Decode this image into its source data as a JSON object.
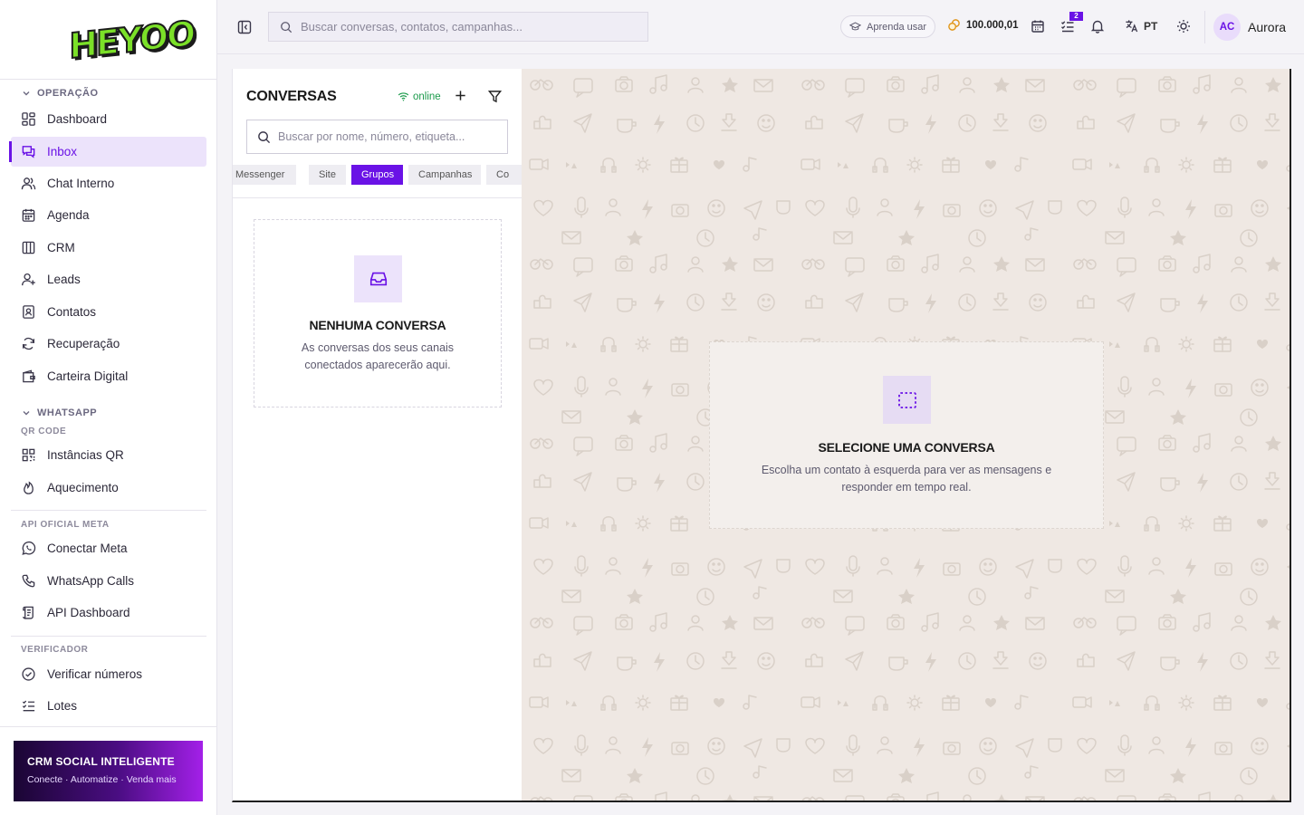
{
  "brand": {
    "logo_text": "HEYOO"
  },
  "sidebar": {
    "sections": [
      {
        "title": "OPERAÇÃO",
        "items": [
          {
            "label": "Dashboard",
            "icon": "dashboard-icon"
          },
          {
            "label": "Inbox",
            "icon": "inbox-icon",
            "active": true
          },
          {
            "label": "Chat Interno",
            "icon": "users-icon"
          },
          {
            "label": "Agenda",
            "icon": "calendar-icon"
          },
          {
            "label": "CRM",
            "icon": "kanban-icon"
          },
          {
            "label": "Leads",
            "icon": "user-plus-icon"
          },
          {
            "label": "Contatos",
            "icon": "contact-book-icon"
          },
          {
            "label": "Recuperação",
            "icon": "refresh-icon"
          },
          {
            "label": "Carteira Digital",
            "icon": "wallet-icon"
          }
        ]
      },
      {
        "title": "WHATSAPP",
        "subtitle": "QR CODE",
        "items": [
          {
            "label": "Instâncias QR",
            "icon": "qr-code-icon"
          },
          {
            "label": "Aquecimento",
            "icon": "flame-icon"
          }
        ]
      },
      {
        "subtitle": "API OFICIAL META",
        "items": [
          {
            "label": "Conectar Meta",
            "icon": "whatsapp-icon"
          },
          {
            "label": "WhatsApp Calls",
            "icon": "phone-icon"
          },
          {
            "label": "API Dashboard",
            "icon": "scroll-icon"
          }
        ]
      },
      {
        "subtitle": "VERIFICADOR",
        "items": [
          {
            "label": "Verificar números",
            "icon": "check-circle-icon"
          },
          {
            "label": "Lotes",
            "icon": "list-check-icon"
          }
        ]
      }
    ],
    "promo": {
      "title": "CRM SOCIAL INTELIGENTE",
      "subtitle": "Conecte · Automatize · Venda mais"
    }
  },
  "topbar": {
    "search_placeholder": "Buscar conversas, contatos, campanhas...",
    "learn_label": "Aprenda usar",
    "credits": "100.000,01",
    "tasks_badge": "2",
    "language": "PT",
    "user_initials": "AC",
    "user_name": "Aurora"
  },
  "conversations": {
    "title": "CONVERSAS",
    "status": "online",
    "search_placeholder": "Buscar por nome, número, etiqueta...",
    "tabs": [
      "Messenger",
      "Site",
      "Grupos",
      "Campanhas",
      "Co"
    ],
    "active_tab": "Grupos",
    "empty_title": "NENHUMA CONVERSA",
    "empty_desc": "As conversas dos seus canais conectados aparecerão aqui."
  },
  "chat": {
    "empty_title": "SELECIONE UMA CONVERSA",
    "empty_desc": "Escolha um contato à esquerda para ver as mensagens e responder em tempo real."
  },
  "colors": {
    "accent": "#6a12e6",
    "accent_soft": "#ece3fb",
    "online": "#1a9a4a",
    "chat_bg": "#efe8e3",
    "logo_green": "#7be028"
  }
}
